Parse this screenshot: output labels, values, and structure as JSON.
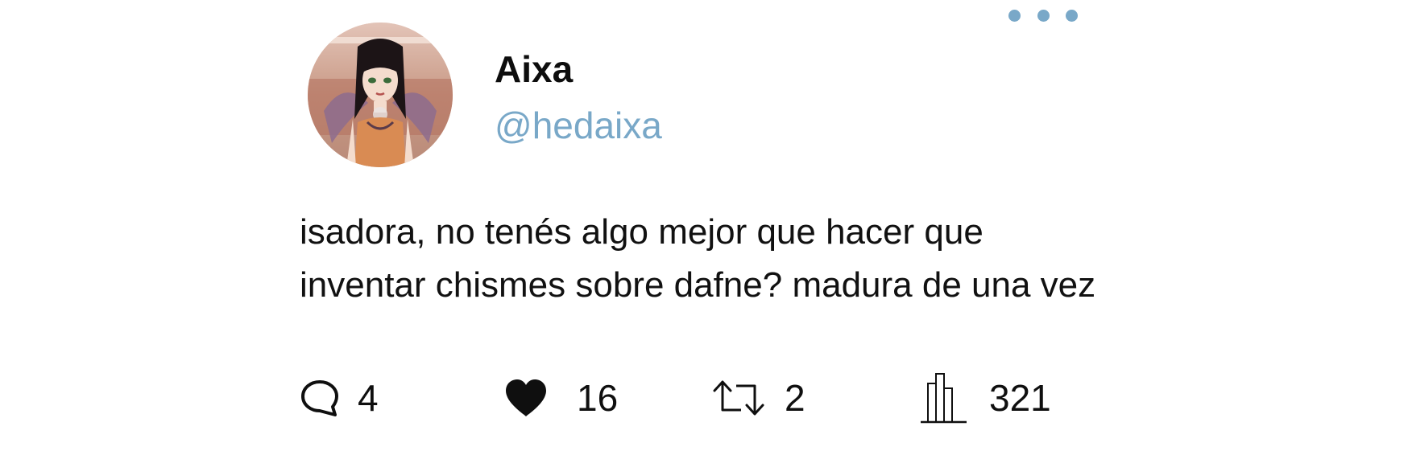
{
  "header": {
    "more_icon": "more-horizontal-icon",
    "accent_color": "#79a8c8"
  },
  "author": {
    "display_name": "Aixa",
    "handle": "@hedaixa",
    "avatar_icon": "avatar-image"
  },
  "tweet": {
    "text": "isadora, no tenés algo mejor que hacer que inventar chismes sobre dafne? madura de una vez"
  },
  "actions": {
    "reply": {
      "icon": "reply-bubble-icon",
      "count": "4"
    },
    "like": {
      "icon": "heart-icon",
      "count": "16"
    },
    "retweet": {
      "icon": "retweet-icon",
      "count": "2"
    },
    "views": {
      "icon": "analytics-bars-icon",
      "count": "321"
    }
  }
}
